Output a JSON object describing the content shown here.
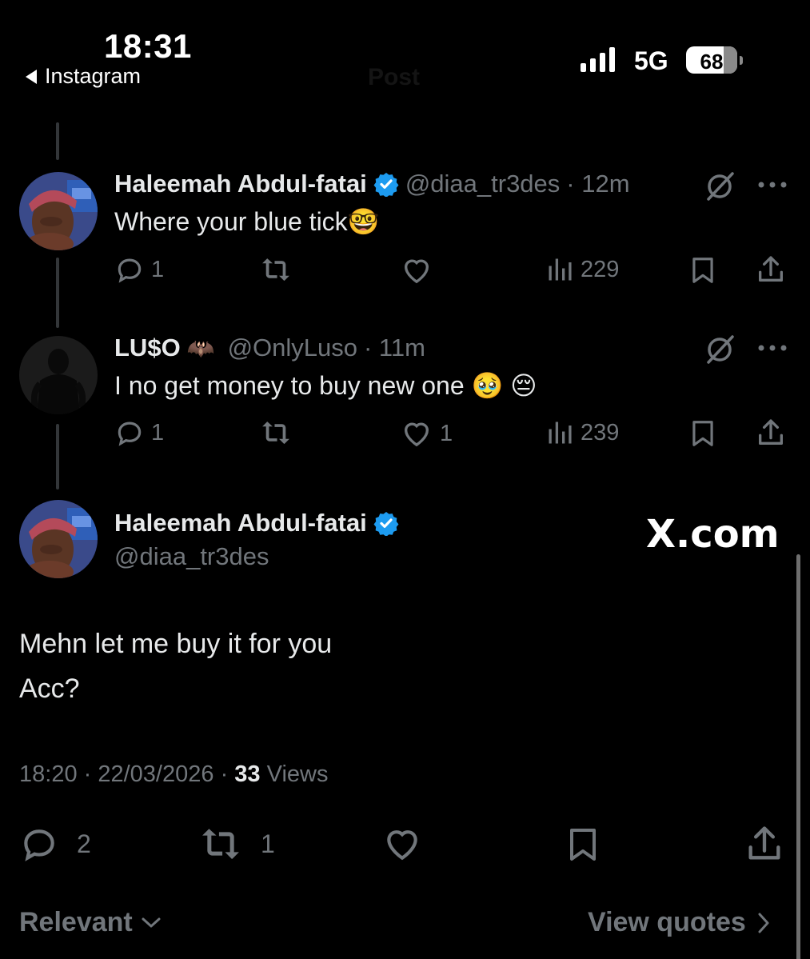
{
  "status_bar": {
    "time": "18:31",
    "back_app": "Instagram",
    "network": "5G",
    "battery": "68",
    "ghost_title": "Post"
  },
  "tweets": [
    {
      "name": "Haleemah Abdul-fatai",
      "handle": "@diaa_tr3des",
      "age": "· 12m",
      "text": "Where your blue tick",
      "emoji": "🤓",
      "verified": true,
      "replies": "1",
      "retweets": "",
      "likes": "",
      "views": "229"
    },
    {
      "name": "LU$O",
      "emoji_name": "🦇",
      "handle": "@OnlyLuso",
      "age": "· 11m",
      "text": "I no get money to buy new one",
      "emoji": "🥹 😔",
      "verified": false,
      "replies": "1",
      "retweets": "",
      "likes": "1",
      "views": "239"
    }
  ],
  "main_post": {
    "name": "Haleemah Abdul-fatai",
    "handle": "@diaa_tr3des",
    "watermark": "X.com",
    "line1": "Mehn let me buy it for you",
    "line2": "Acc?",
    "time": "18:20",
    "date": "22/03/2026",
    "views_count": "33",
    "views_label": "Views",
    "replies": "2",
    "retweets": "1"
  },
  "footer": {
    "sort": "Relevant",
    "quotes": "View quotes"
  },
  "colors": {
    "background": "#000000",
    "text": "#e7e9ea",
    "muted": "#71767b",
    "verified": "#1d9bf0"
  }
}
